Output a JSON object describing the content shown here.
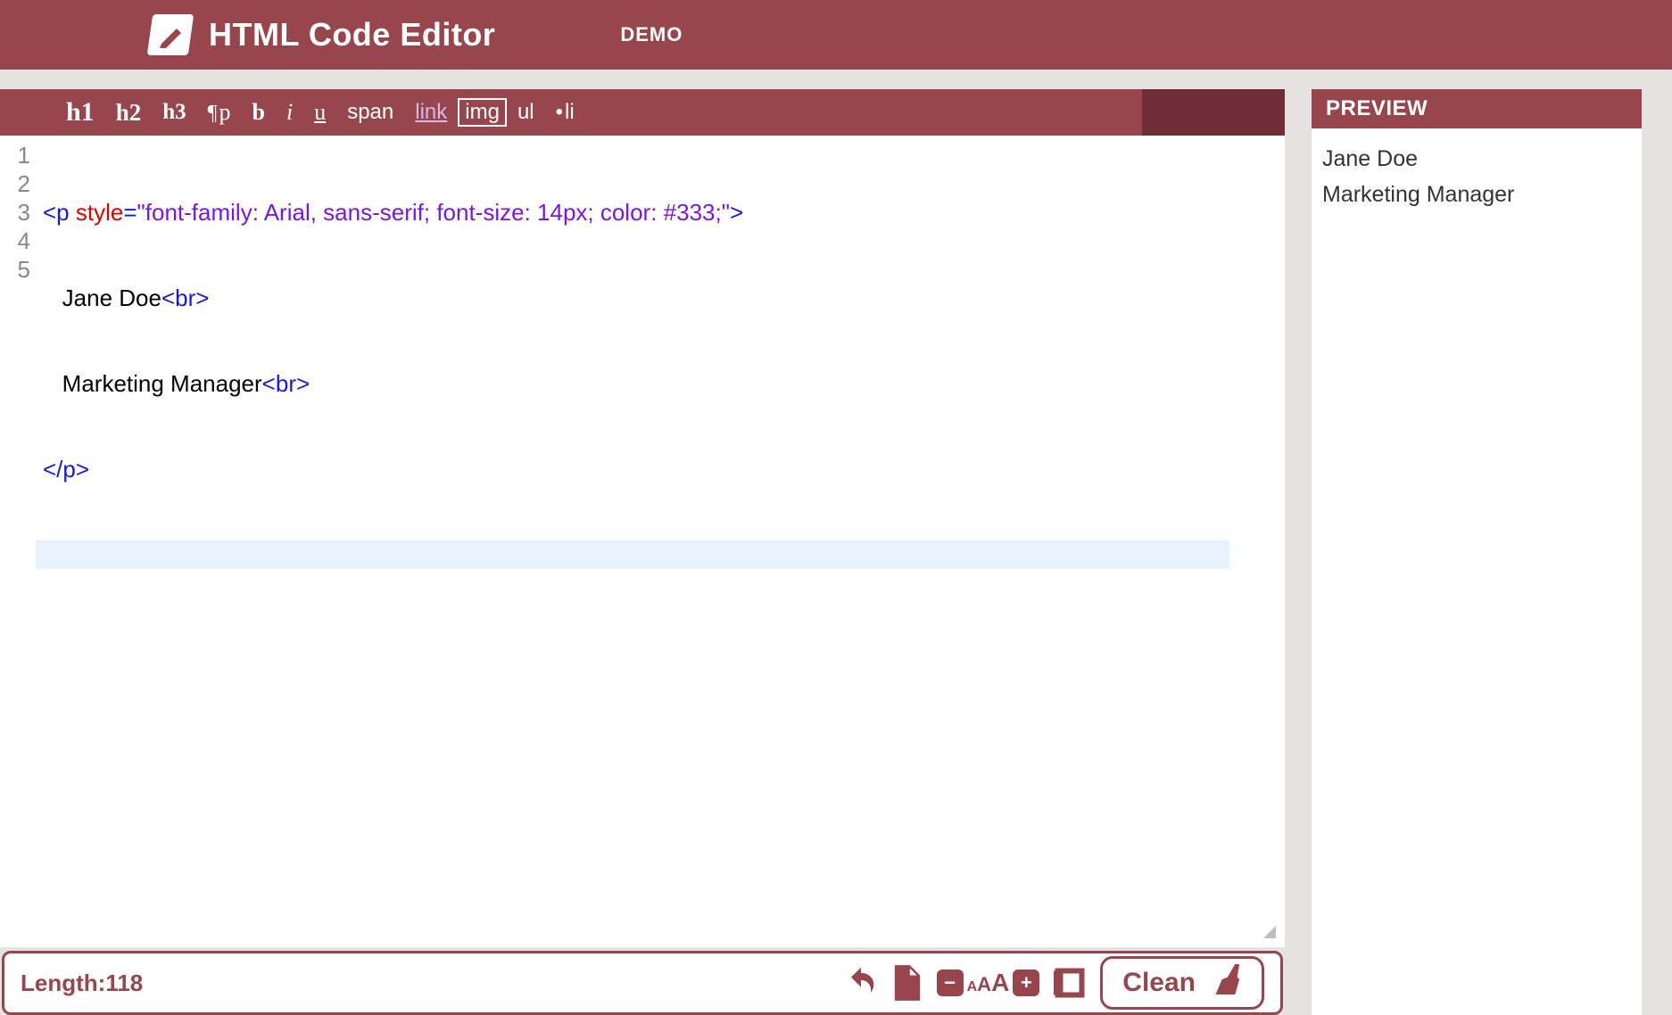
{
  "header": {
    "title": "HTML Code Editor",
    "demo": "DEMO"
  },
  "toolbar": {
    "h1": "h1",
    "h2": "h2",
    "h3": "h3",
    "p": "p",
    "b": "b",
    "i": "i",
    "u": "u",
    "span": "span",
    "link": "link",
    "img": "img",
    "ul": "ul",
    "li": "li"
  },
  "gutter": [
    "1",
    "2",
    "3",
    "4",
    "5"
  ],
  "code": {
    "l1_open": "<p",
    "l1_sp": " ",
    "l1_attr": "style",
    "l1_eq": "=",
    "l1_val": "\"font-family: Arial, sans-serif; font-size: 14px; color: #333;\"",
    "l1_close": ">",
    "l2_indent": "   ",
    "l2_text": "Jane Doe",
    "l2_br": "<br>",
    "l3_indent": "   ",
    "l3_text": "Marketing Manager",
    "l3_br": "<br>",
    "l4": "</p>"
  },
  "footer": {
    "length_label": "Length: ",
    "length_value": "118",
    "minus": "−",
    "a1": "A",
    "a2": "A",
    "a3": "A",
    "plus": "+",
    "clean": "Clean"
  },
  "preview": {
    "title": "PREVIEW",
    "line1": "Jane Doe",
    "line2": "Marketing Manager"
  }
}
